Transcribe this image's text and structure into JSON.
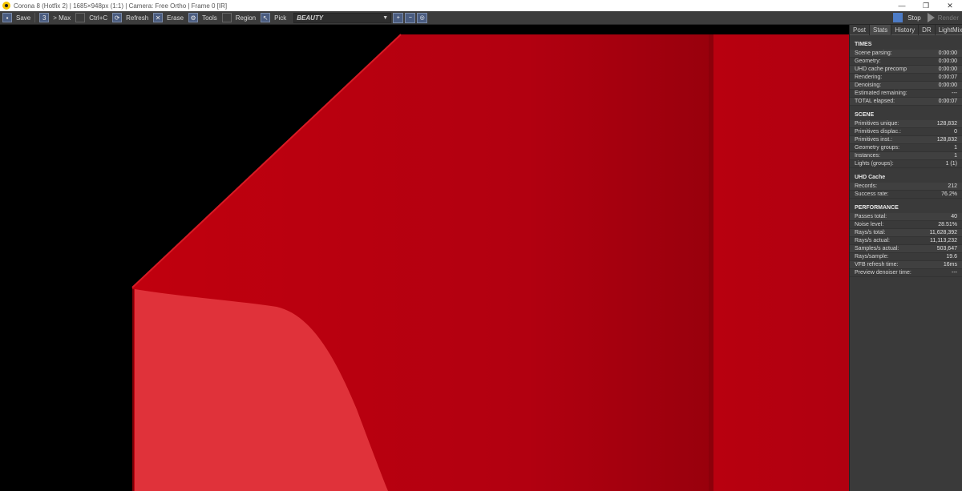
{
  "window": {
    "title": "Corona 8 (Hotfix 2) | 1685×948px (1:1) | Camera: Free Ortho | Frame 0 [IR]",
    "minimize_glyph": "—",
    "restore_glyph": "❐",
    "close_glyph": "✕"
  },
  "toolbar": {
    "save": "Save",
    "max": "> Max",
    "copy": "Ctrl+C",
    "refresh": "Refresh",
    "erase": "Erase",
    "tools": "Tools",
    "region": "Region",
    "pick": "Pick",
    "pass": "BEAUTY",
    "stop": "Stop",
    "render": "Render"
  },
  "panel": {
    "tabs": [
      "Post",
      "Stats",
      "History",
      "DR",
      "LightMix"
    ],
    "active_tab": "Stats",
    "sections": [
      {
        "heading": "TIMES",
        "rows": [
          {
            "label": "Scene parsing:",
            "value": "0:00:00"
          },
          {
            "label": "Geometry:",
            "value": "0:00:00"
          },
          {
            "label": "UHD cache precomp",
            "value": "0:00:00"
          },
          {
            "label": "Rendering:",
            "value": "0:00:07"
          },
          {
            "label": "Denoising:",
            "value": "0:00:00"
          },
          {
            "label": "Estimated remaining:",
            "value": "---"
          },
          {
            "label": "TOTAL elapsed:",
            "value": "0:00:07"
          }
        ]
      },
      {
        "heading": "SCENE",
        "rows": [
          {
            "label": "Primitives unique:",
            "value": "128,832"
          },
          {
            "label": "Primitives displac.:",
            "value": "0"
          },
          {
            "label": "Primitives inst.:",
            "value": "128,832"
          },
          {
            "label": "Geometry groups:",
            "value": "1"
          },
          {
            "label": "Instances:",
            "value": "1"
          },
          {
            "label": "Lights (groups):",
            "value": "1 (1)"
          }
        ]
      },
      {
        "heading": "UHD Cache",
        "rows": [
          {
            "label": "Records:",
            "value": "212"
          },
          {
            "label": "Success rate:",
            "value": "76.2%"
          }
        ]
      },
      {
        "heading": "PERFORMANCE",
        "rows": [
          {
            "label": "Passes total:",
            "value": "40"
          },
          {
            "label": "Noise level:",
            "value": "28.51%"
          },
          {
            "label": "Rays/s total:",
            "value": "11,628,392"
          },
          {
            "label": "Rays/s actual:",
            "value": "11,113,232"
          },
          {
            "label": "Samples/s actual:",
            "value": "503,647"
          },
          {
            "label": "Rays/sample:",
            "value": "19.6"
          },
          {
            "label": "VFB refresh time:",
            "value": "16ms"
          },
          {
            "label": "Preview denoiser time:",
            "value": "---"
          }
        ]
      }
    ]
  },
  "colors": {
    "accent": "#4d7cc7",
    "object_red": "#b8000e",
    "object_light_red": "#e0323a"
  }
}
